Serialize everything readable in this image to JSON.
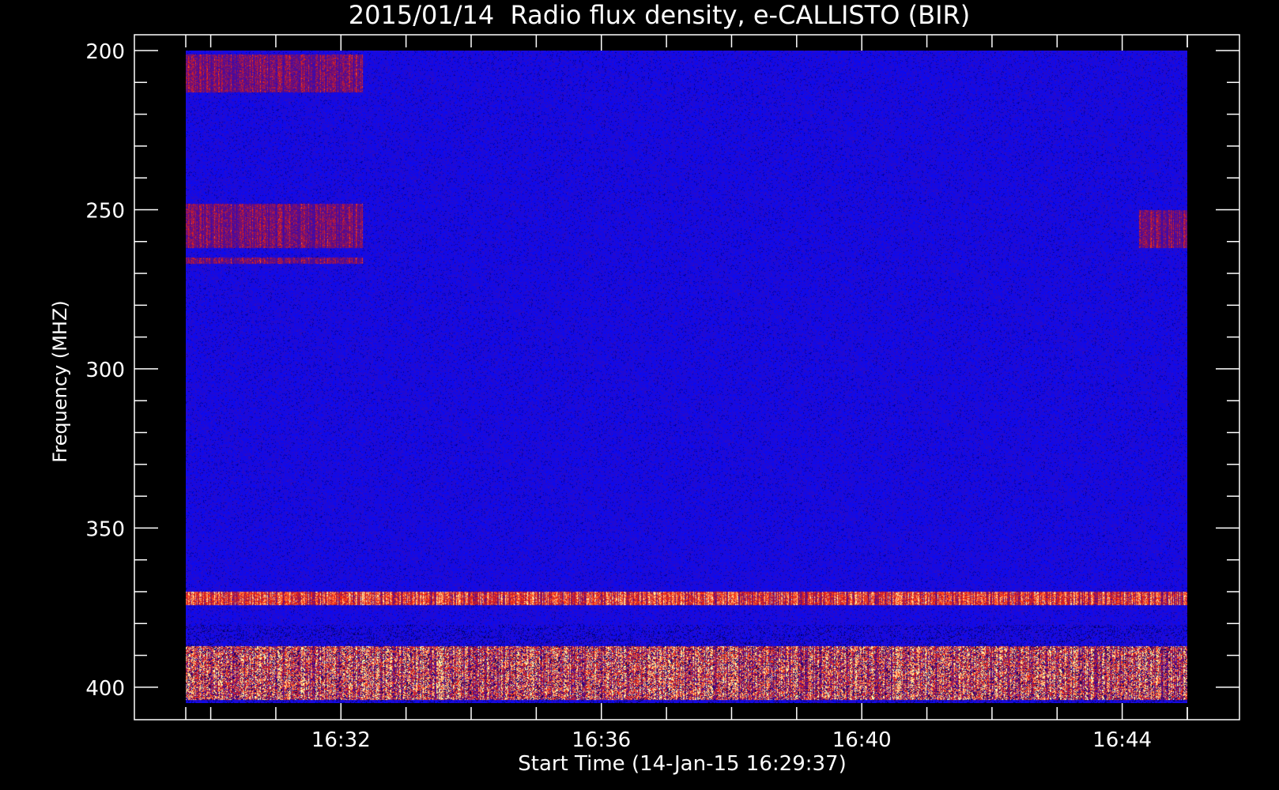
{
  "chart_data": {
    "type": "heatmap",
    "title": "2015/01/14  Radio flux density, e-CALLISTO (BIR)",
    "xlabel": "Start Time (14-Jan-15 16:29:37)",
    "ylabel": "Frequency (MHZ)",
    "x_range": [
      "16:29:37",
      "16:45:00"
    ],
    "y_range": [
      200,
      405
    ],
    "y_inverted": true,
    "x_ticks": [
      "16:32",
      "16:36",
      "16:40",
      "16:44"
    ],
    "y_ticks": [
      200,
      250,
      300,
      350,
      400
    ],
    "colormap": [
      "#000000",
      "#1010ff",
      "#ff2000",
      "#ffff80"
    ],
    "background": "#000000",
    "features": [
      {
        "type": "band",
        "freq_mhz": [
          201,
          213
        ],
        "t_start": "16:29:37",
        "t_end": "16:32:20",
        "intensity": "medium"
      },
      {
        "type": "band",
        "freq_mhz": [
          248,
          262
        ],
        "t_start": "16:29:37",
        "t_end": "16:32:20",
        "intensity": "medium"
      },
      {
        "type": "band",
        "freq_mhz": [
          265,
          267
        ],
        "t_start": "16:29:37",
        "t_end": "16:32:20",
        "intensity": "medium"
      },
      {
        "type": "band",
        "freq_mhz": [
          250,
          262
        ],
        "t_start": "16:44:15",
        "t_end": "16:45:00",
        "intensity": "medium"
      },
      {
        "type": "band",
        "freq_mhz": [
          370,
          374
        ],
        "t_start": "16:29:37",
        "t_end": "16:45:00",
        "intensity": "high"
      },
      {
        "type": "band",
        "freq_mhz": [
          387,
          404
        ],
        "t_start": "16:29:37",
        "t_end": "16:45:00",
        "intensity": "very high"
      }
    ]
  }
}
